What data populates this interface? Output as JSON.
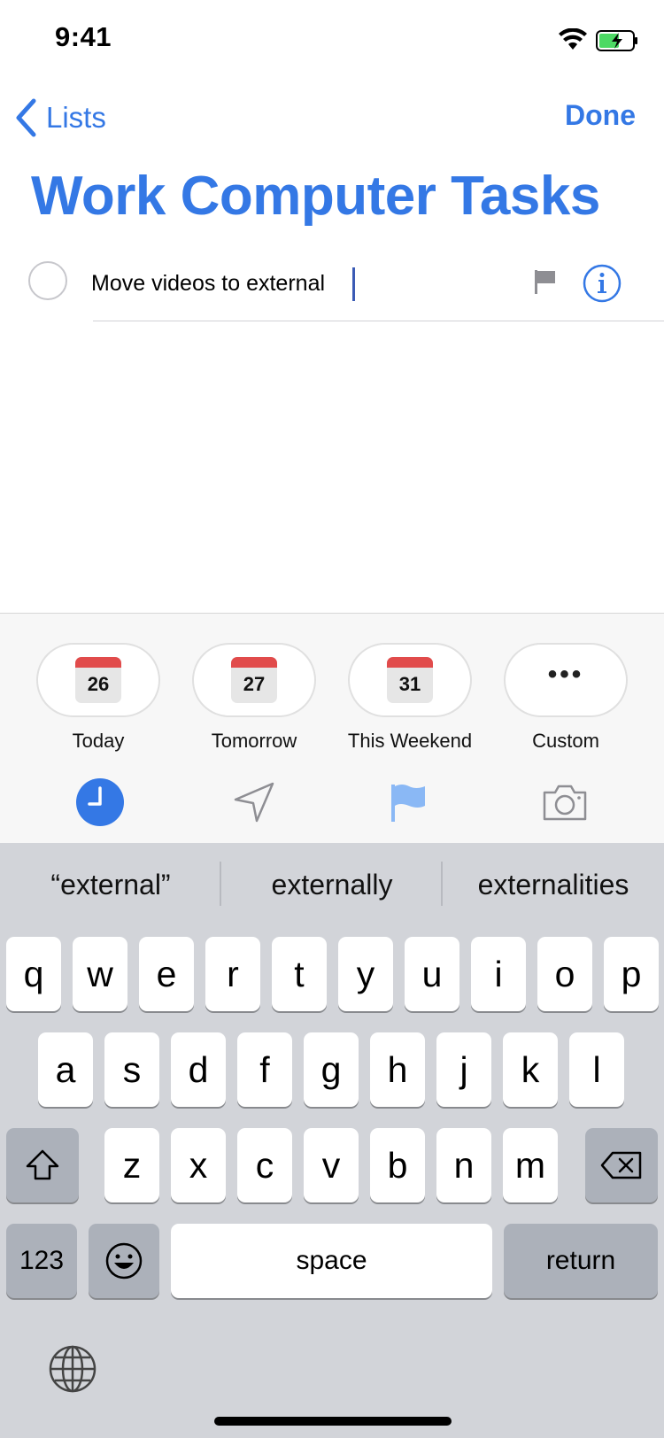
{
  "status": {
    "time": "9:41"
  },
  "nav": {
    "back_label": "Lists",
    "done_label": "Done"
  },
  "list": {
    "title": "Work Computer Tasks"
  },
  "task": {
    "text": "Move videos to external"
  },
  "quick_dates": [
    {
      "day": "26",
      "label": "Today"
    },
    {
      "day": "27",
      "label": "Tomorrow"
    },
    {
      "day": "31",
      "label": "This Weekend"
    },
    {
      "label": "Custom"
    }
  ],
  "toolbar": {
    "icons": [
      "clock-icon",
      "location-arrow-icon",
      "flag-icon",
      "camera-icon"
    ]
  },
  "suggestions": [
    "“external”",
    "externally",
    "externalities"
  ],
  "keyboard": {
    "row1": [
      "q",
      "w",
      "e",
      "r",
      "t",
      "y",
      "u",
      "i",
      "o",
      "p"
    ],
    "row2": [
      "a",
      "s",
      "d",
      "f",
      "g",
      "h",
      "j",
      "k",
      "l"
    ],
    "row3": [
      "z",
      "x",
      "c",
      "v",
      "b",
      "n",
      "m"
    ],
    "numbers_label": "123",
    "space_label": "space",
    "return_label": "return"
  },
  "colors": {
    "accent": "#3478e5",
    "calendar_red": "#e14b4b",
    "flag_blue": "#8ab8f5",
    "keyboard_bg": "#d2d4d9"
  }
}
